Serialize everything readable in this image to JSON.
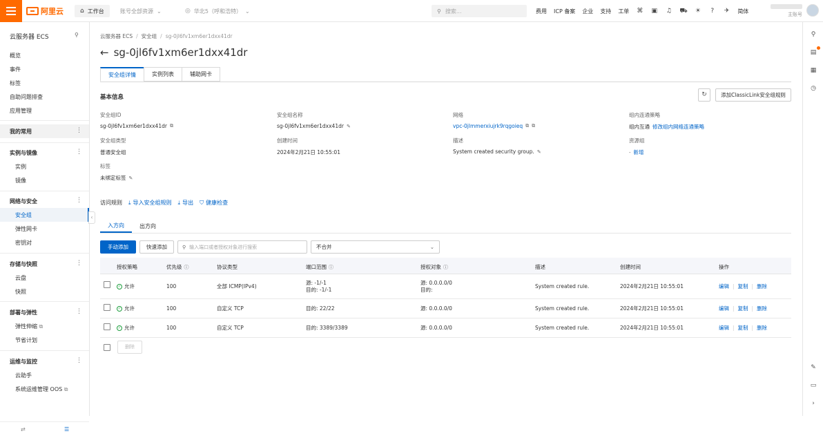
{
  "topbar": {
    "brand": "阿里云",
    "workbench": "工作台",
    "account_scope": "账号全部资源",
    "region": "华北5（呼和浩特）",
    "search_placeholder": "搜索...",
    "links": [
      "费用",
      "ICP 备案",
      "企业",
      "支持",
      "工单"
    ],
    "language": "简体",
    "user_sub": "主账号",
    "accent_color": "#ff6a00"
  },
  "sidebar": {
    "title": "云服务器 ECS",
    "top_items": [
      "概览",
      "事件",
      "标签",
      "自助问题排查",
      "应用管理"
    ],
    "favorites": "我的常用",
    "groups": [
      {
        "title": "实例与镜像",
        "items": [
          "实例",
          "镜像"
        ]
      },
      {
        "title": "网络与安全",
        "items": [
          "安全组",
          "弹性网卡",
          "密钥对"
        ]
      },
      {
        "title": "存储与快照",
        "items": [
          "云盘",
          "快照"
        ]
      },
      {
        "title": "部署与弹性",
        "items": [
          "弹性伸缩",
          "节省计划"
        ]
      },
      {
        "title": "运维与监控",
        "items": [
          "云助手",
          "系统运维管理 OOS"
        ]
      }
    ],
    "active_item": "安全组"
  },
  "breadcrumb": [
    "云服务器 ECS",
    "安全组",
    "sg-0jl6fv1xm6er1dxx41dr"
  ],
  "page_title": "sg-0jl6fv1xm6er1dxx41dr",
  "tabs": [
    "安全组详情",
    "实例列表",
    "辅助网卡"
  ],
  "basic": {
    "section_title": "基本信息",
    "add_classic_button": "添加ClassicLink安全组规则",
    "fields": {
      "sg_id_label": "安全组ID",
      "sg_id": "sg-0jl6fv1xm6er1dxx41dr",
      "sg_name_label": "安全组名称",
      "sg_name": "sg-0jl6fv1xm6er1dxx41dr",
      "network_label": "网络",
      "network": "vpc-0jlmmerxiujrk9rqgoieq",
      "intra_label": "组内连通策略",
      "intra_value": "组内互通",
      "intra_link": "修改组内网络连通策略",
      "type_label": "安全组类型",
      "type": "普通安全组",
      "created_label": "创建时间",
      "created": "2024年2月21日 10:55:01",
      "desc_label": "描述",
      "desc": "System created security group.",
      "rg_label": "资源组",
      "rg_value": "新增",
      "tags_label": "标签",
      "tags_value": "未绑定标签"
    }
  },
  "rules": {
    "title": "访问规则",
    "import": "导入安全组规则",
    "export": "导出",
    "health": "健康检查",
    "direction_tabs": [
      "入方向",
      "出方向"
    ],
    "manual_add": "手动添加",
    "quick_add": "快速添加",
    "search_placeholder": "输入端口或者授权对象进行搜索",
    "merge_select": "不合并",
    "columns": [
      "授权策略",
      "优先级",
      "协议类型",
      "端口范围",
      "授权对象",
      "描述",
      "创建时间",
      "操作"
    ],
    "rows": [
      {
        "policy": "允许",
        "priority": "100",
        "protocol": "全部 ICMP(IPv4)",
        "port_src": "源: -1/-1",
        "port_dst": "目的: -1/-1",
        "obj_src": "源: 0.0.0.0/0",
        "obj_dst": "目的:",
        "desc": "System created rule.",
        "created": "2024年2月21日 10:55:01"
      },
      {
        "policy": "允许",
        "priority": "100",
        "protocol": "自定义 TCP",
        "port_src": "目的: 22/22",
        "port_dst": "",
        "obj_src": "源: 0.0.0.0/0",
        "obj_dst": "",
        "desc": "System created rule.",
        "created": "2024年2月21日 10:55:01"
      },
      {
        "policy": "允许",
        "priority": "100",
        "protocol": "自定义 TCP",
        "port_src": "目的: 3389/3389",
        "port_dst": "",
        "obj_src": "源: 0.0.0.0/0",
        "obj_dst": "",
        "desc": "System created rule.",
        "created": "2024年2月21日 10:55:01"
      }
    ],
    "ops": [
      "编辑",
      "复制",
      "删除"
    ],
    "batch_delete": "删除"
  }
}
